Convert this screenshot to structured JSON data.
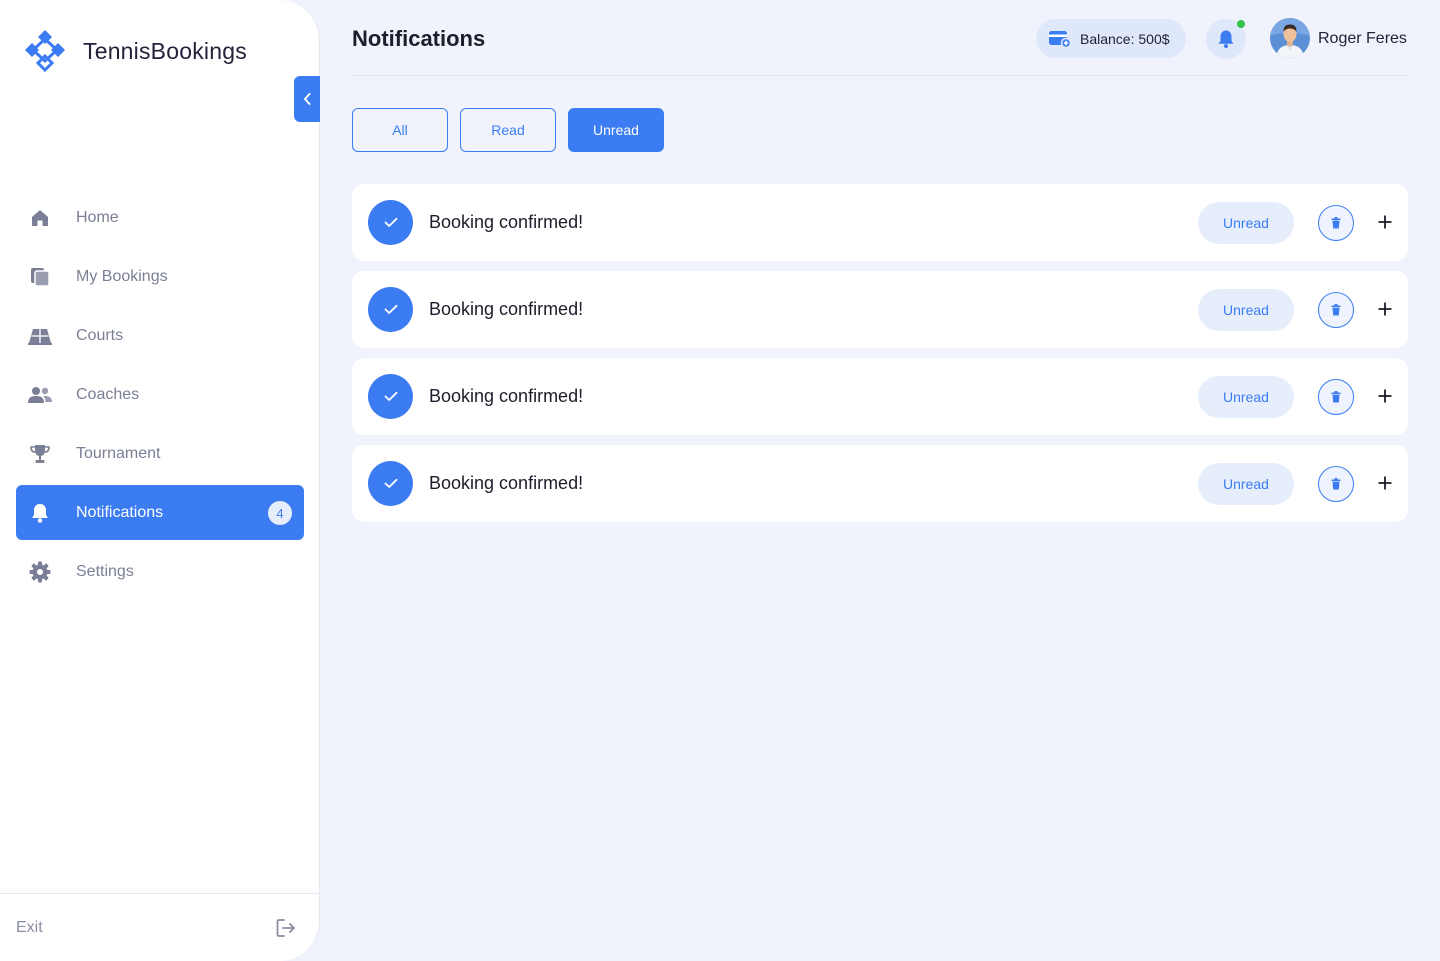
{
  "brand": {
    "name": "TennisBookings",
    "accent_color": "#3b7cf2"
  },
  "sidebar": {
    "items": [
      {
        "label": "Home",
        "icon": "home-icon"
      },
      {
        "label": "My Bookings",
        "icon": "bookings-icon"
      },
      {
        "label": "Courts",
        "icon": "court-icon"
      },
      {
        "label": "Coaches",
        "icon": "people-icon"
      },
      {
        "label": "Tournament",
        "icon": "trophy-icon"
      },
      {
        "label": "Notifications",
        "icon": "bell-icon",
        "active": true,
        "badge": "4"
      },
      {
        "label": "Settings",
        "icon": "gear-icon"
      }
    ],
    "exit_label": "Exit"
  },
  "header": {
    "title": "Notifications",
    "balance": "Balance: 500$",
    "user_name": "Roger Feres",
    "has_unread_indicator": true
  },
  "filters": {
    "all": "All",
    "read": "Read",
    "unread": "Unread",
    "selected": "Unread"
  },
  "notifications": [
    {
      "title": "Booking confirmed!",
      "status": "Unread"
    },
    {
      "title": "Booking confirmed!",
      "status": "Unread"
    },
    {
      "title": "Booking confirmed!",
      "status": "Unread"
    },
    {
      "title": "Booking confirmed!",
      "status": "Unread"
    }
  ]
}
